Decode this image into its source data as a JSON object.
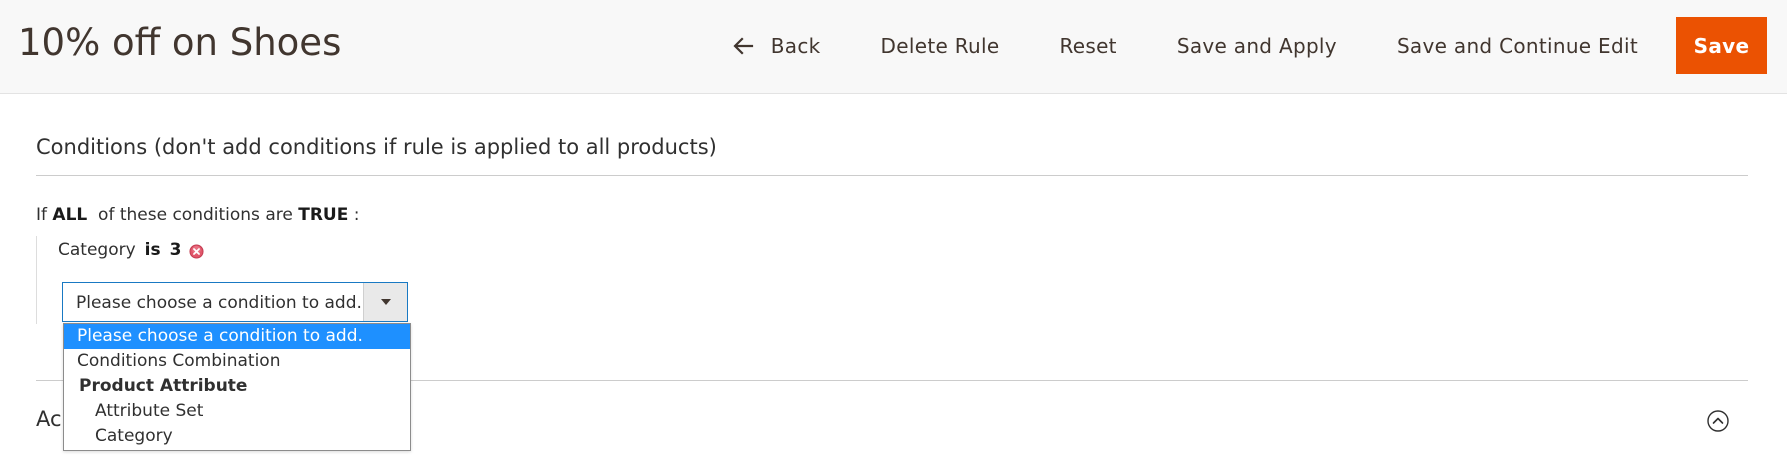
{
  "header": {
    "title": "10% off on Shoes",
    "actions": {
      "back_label": "Back",
      "delete_label": "Delete Rule",
      "reset_label": "Reset",
      "save_apply_label": "Save and Apply",
      "save_continue_label": "Save and Continue Edit",
      "save_label": "Save"
    },
    "colors": {
      "save_button_bg": "#eb5202",
      "header_bg": "#f8f8f8"
    }
  },
  "conditions": {
    "section_title": "Conditions (don't add conditions if rule is applied to all products)",
    "rule_prefix": "If",
    "aggregator": "ALL",
    "rule_middle": "of these conditions are",
    "value": "TRUE",
    "rule_suffix": ":",
    "items": [
      {
        "attribute": "Category",
        "operator": "is",
        "value": "3",
        "remove_icon": "remove-circle-icon"
      }
    ],
    "new_condition_select": {
      "selected": "Please choose a condition to add.",
      "options": [
        {
          "label": "Please choose a condition to add.",
          "type": "option",
          "selected": true
        },
        {
          "label": "Conditions Combination",
          "type": "option"
        },
        {
          "label": "Product Attribute",
          "type": "group"
        },
        {
          "label": "Attribute Set",
          "type": "sub-option"
        },
        {
          "label": "Category",
          "type": "sub-option"
        }
      ],
      "highlight_color": "#1e90ff"
    }
  },
  "actions_section": {
    "title_visible": "Ac",
    "toggle_icon": "chevron-up-circle-icon"
  }
}
